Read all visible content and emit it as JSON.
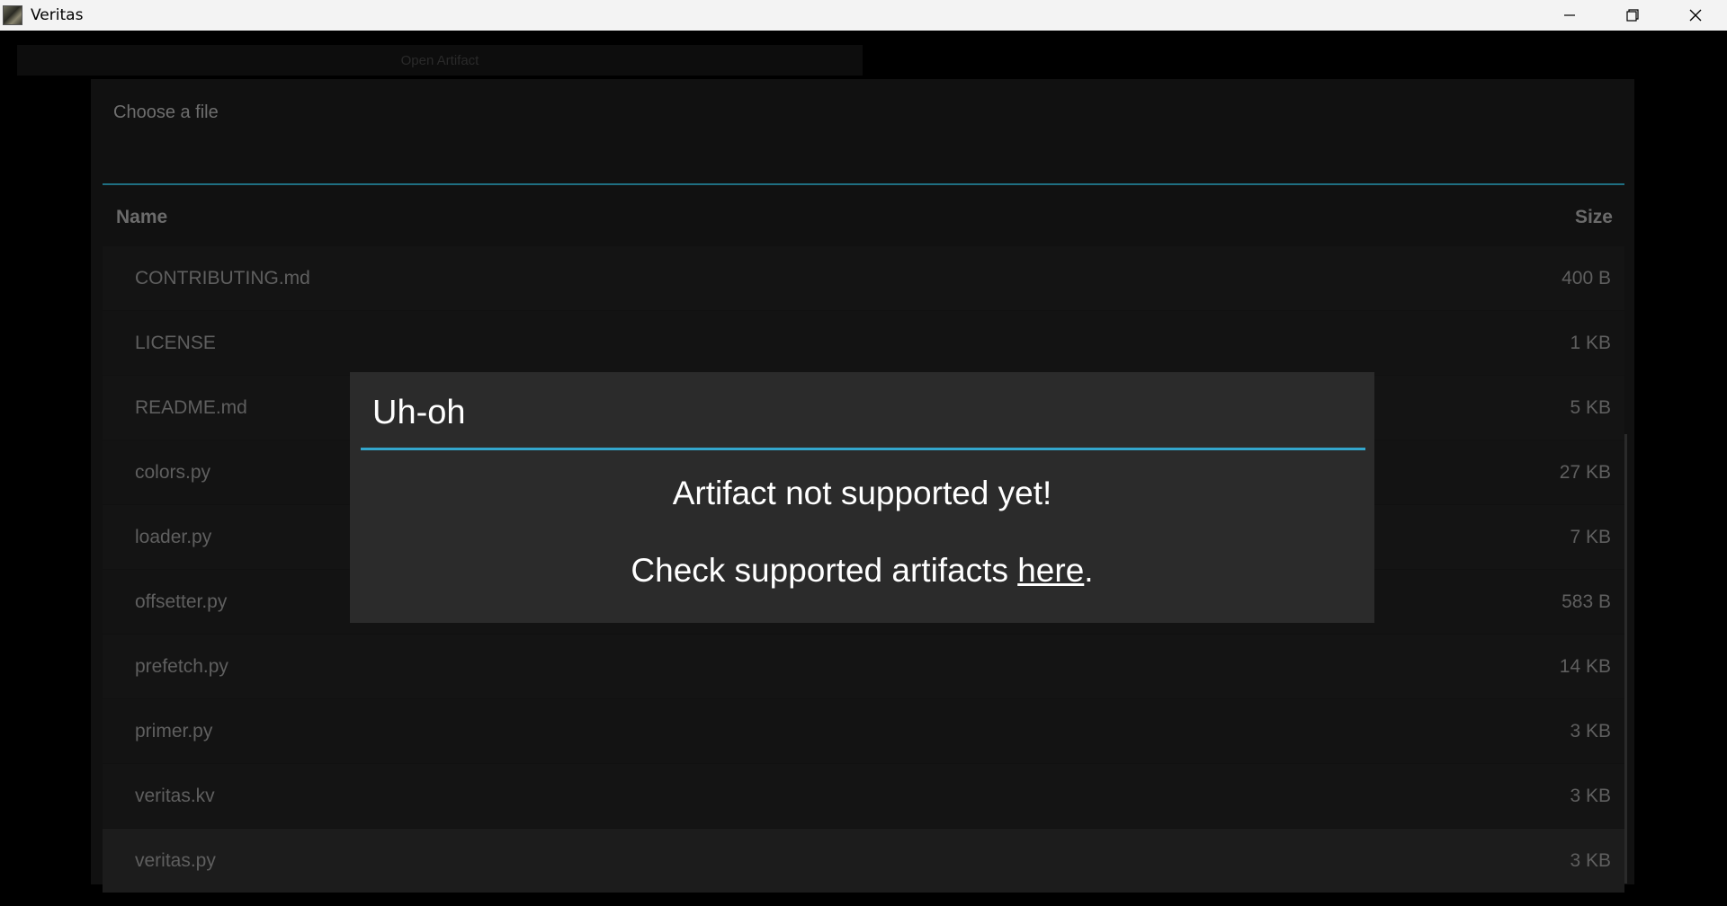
{
  "window": {
    "title": "Veritas",
    "icon": "app-icon"
  },
  "toolbar": {
    "open_artifact_label": "Open Artifact"
  },
  "file_chooser": {
    "title": "Choose a file",
    "columns": {
      "name": "Name",
      "size": "Size"
    },
    "files": [
      {
        "name": "CONTRIBUTING.md",
        "size": "400 B"
      },
      {
        "name": "LICENSE",
        "size": "1 KB"
      },
      {
        "name": "README.md",
        "size": "5 KB"
      },
      {
        "name": "colors.py",
        "size": "27 KB"
      },
      {
        "name": "loader.py",
        "size": "7 KB"
      },
      {
        "name": "offsetter.py",
        "size": "583 B"
      },
      {
        "name": "prefetch.py",
        "size": "14 KB"
      },
      {
        "name": "primer.py",
        "size": "3 KB"
      },
      {
        "name": "veritas.kv",
        "size": "3 KB"
      },
      {
        "name": "veritas.py",
        "size": "3 KB"
      }
    ],
    "selected_file": "veritas.py"
  },
  "dialog": {
    "title": "Uh-oh",
    "message": "Artifact not supported yet!",
    "link_prefix": "Check supported artifacts ",
    "link_text": "here",
    "link_suffix": "."
  },
  "colors": {
    "accent": "#33a6cc",
    "dialog_bg": "#2b2b2b",
    "background": "#000000"
  }
}
